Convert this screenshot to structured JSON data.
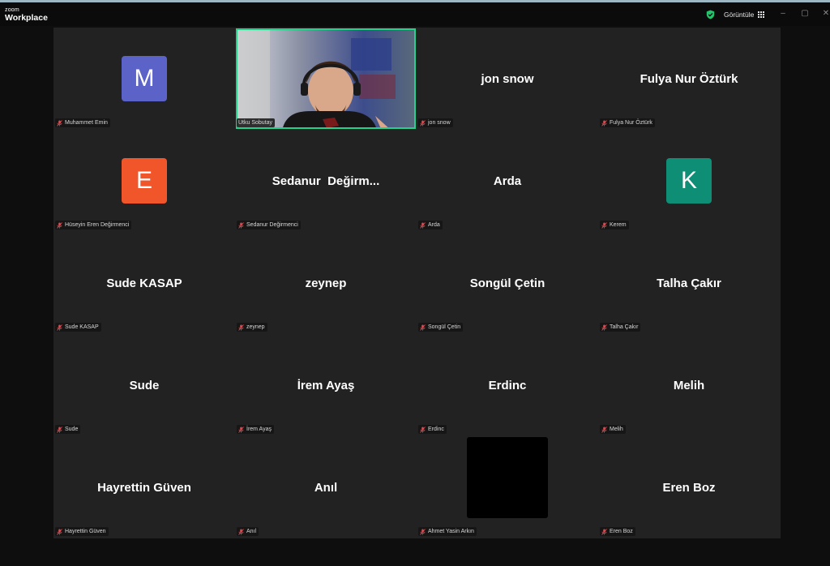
{
  "titlebar": {
    "brand_small": "zoom",
    "brand_big": "Workplace",
    "view_label": "Görüntüle",
    "minimize": "–",
    "maximize": "▢",
    "close": "✕"
  },
  "colors": {
    "active_speaker_border": "#23d18b",
    "tile_bg": "#222222",
    "muted_mic": "#e5484d",
    "shield": "#23c36b"
  },
  "participants": [
    {
      "label": "Muhammet Emin",
      "avatar_letter": "M",
      "avatar_color": "#5b63c9",
      "muted": true
    },
    {
      "label": "Utku Sobutay",
      "video": true,
      "active_speaker": true
    },
    {
      "label": "jon snow",
      "display": "jon snow",
      "muted": true
    },
    {
      "label": "Fulya Nur Öztürk",
      "display": "Fulya Nur Öztürk",
      "muted": true
    },
    {
      "label": "Hüseyin Eren Değirmenci",
      "avatar_letter": "E",
      "avatar_color": "#f1562a",
      "muted": true
    },
    {
      "label": "Sedanur Değirmenci",
      "display": "Sedanur  Değirm...",
      "muted": true
    },
    {
      "label": "Arda",
      "display": "Arda",
      "muted": true
    },
    {
      "label": "Kerem",
      "avatar_letter": "K",
      "avatar_color": "#0f8e76",
      "muted": true
    },
    {
      "label": "Sude KASAP",
      "display": "Sude KASAP",
      "muted": true
    },
    {
      "label": "zeynep",
      "display": "zeynep",
      "muted": true
    },
    {
      "label": "Songül Çetin",
      "display": "Songül Çetin",
      "muted": true
    },
    {
      "label": "Talha Çakır",
      "display": "Talha Çakır",
      "muted": true
    },
    {
      "label": "Sude",
      "display": "Sude",
      "muted": true
    },
    {
      "label": "İrem Ayaş",
      "display": "İrem Ayaş",
      "muted": true
    },
    {
      "label": "Erdinc",
      "display": "Erdinc",
      "muted": true
    },
    {
      "label": "Melih",
      "display": "Melih",
      "muted": true
    },
    {
      "label": "Hayrettin Güven",
      "display": "Hayrettin Güven",
      "muted": true
    },
    {
      "label": "Anıl",
      "display": "Anıl",
      "muted": true
    },
    {
      "label": "Ahmet Yasin Arkın",
      "black_video": true,
      "muted": true
    },
    {
      "label": "Eren Boz",
      "display": "Eren Boz",
      "muted": true
    }
  ]
}
